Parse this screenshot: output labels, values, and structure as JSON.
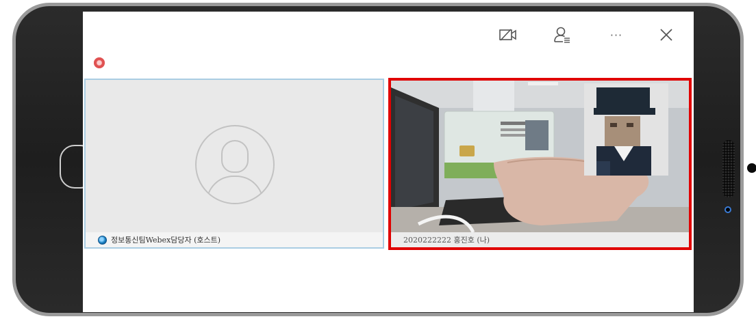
{
  "toolbar": {
    "icons": [
      "video-off-icon",
      "participants-icon",
      "more-icon",
      "close-icon"
    ],
    "more_label": "···",
    "close_label": "✕"
  },
  "recording": {
    "color": "#e05252"
  },
  "participants": [
    {
      "name": "정보통신팀Webex담당자 (호스트)",
      "role": "host",
      "video": false
    },
    {
      "name": "2020222222 홍진호 (나)",
      "role": "self",
      "video": true
    }
  ],
  "colors": {
    "active_speaker_border": "#e00000",
    "tile_border": "#a9cde3",
    "tile_bg": "#e9e9e9"
  }
}
